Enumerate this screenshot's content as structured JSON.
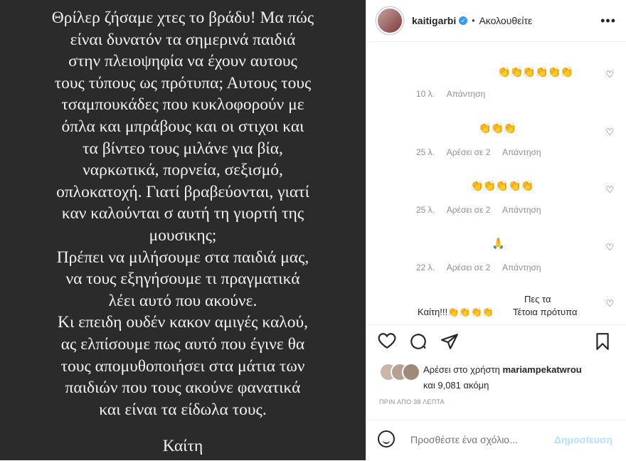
{
  "post_image": {
    "text": "Θρίλερ ζήσαμε χτες το βράδυ! Μα πώς\nείναι δυνατόν τα σημερινά παιδιά\nστην πλειοψηφία να έχουν αυτους\nτους τύπους ως πρότυπα; Αυτους τους\nτσαμπουκάδες που κυκλοφορούν με\nόπλα και μπράβους και οι στιχοι και\nτα βίντεο τους μιλάνε για βία,\nναρκωτικά, πορνεία, σεξισμό,\nοπλοκατοχή. Γιατί βραβεύονται, γιατί\nκαν καλούνται σ αυτή τη γιορτή της\nμουσικης;\nΠρέπει να μιλήσουμε στα παιδιά μας,\nνα τους εξηγήσουμε τι πραγματικά\nλέει αυτό που ακούνε.\nΚι επειδη ουδέν κακον αμιγές καλού,\nας ελπίσουμε πως αυτό που έγινε θα\nτους απομυθοποιήσει στα μάτια των\nπαιδιών που τους ακούνε φανατικά\nκαι είναι τα είδωλα τους.",
    "signature": "Καίτη"
  },
  "header": {
    "username": "kaitigarbi",
    "verified_icon": "verified-badge-icon",
    "separator": "•",
    "follow_label": "Ακολουθείτε",
    "more_icon": "more-options-icon",
    "more_glyph": "•••"
  },
  "comments": [
    {
      "text": "👏👏👏👏👏👏",
      "time": "10 λ.",
      "likes": "",
      "reply": "Απάντηση"
    },
    {
      "text": "👏👏👏",
      "time": "25 λ.",
      "likes": "Αρέσει σε 2",
      "reply": "Απάντηση"
    },
    {
      "text": "👏👏👏👏👏",
      "time": "25 λ.",
      "likes": "Αρέσει σε 2",
      "reply": "Απάντηση"
    },
    {
      "text": "🙏",
      "time": "22 λ.",
      "likes": "Αρέσει σε 2",
      "reply": "Απάντηση"
    },
    {
      "text_line1": "Πες τα",
      "text_line2_a": "Καίτη!!!👏👏👏👏",
      "text_line2_b": "Τέτοια πρότυπα"
    }
  ],
  "heart_glyph": "♡",
  "actions": {
    "like_icon": "heart-icon",
    "comment_icon": "comment-icon",
    "share_icon": "share-icon",
    "save_icon": "bookmark-icon"
  },
  "likes": {
    "line1_prefix": "Αρέσει στο χρήστη",
    "user": "mariampekatwrou",
    "line2": "και 9,081 ακόμη"
  },
  "timestamp": "ΠΡΙΝ ΑΠΟ 38 ΛΕΠΤΑ",
  "add_comment": {
    "placeholder": "Προσθέστε ένα σχόλιο...",
    "post_label": "Δημοσίευση",
    "emoji_icon": "smiley-icon"
  },
  "colors": {
    "post_bg": "#2b2b2b",
    "link_blue_disabled": "#b2dffc",
    "verified_blue": "#3897f0"
  }
}
